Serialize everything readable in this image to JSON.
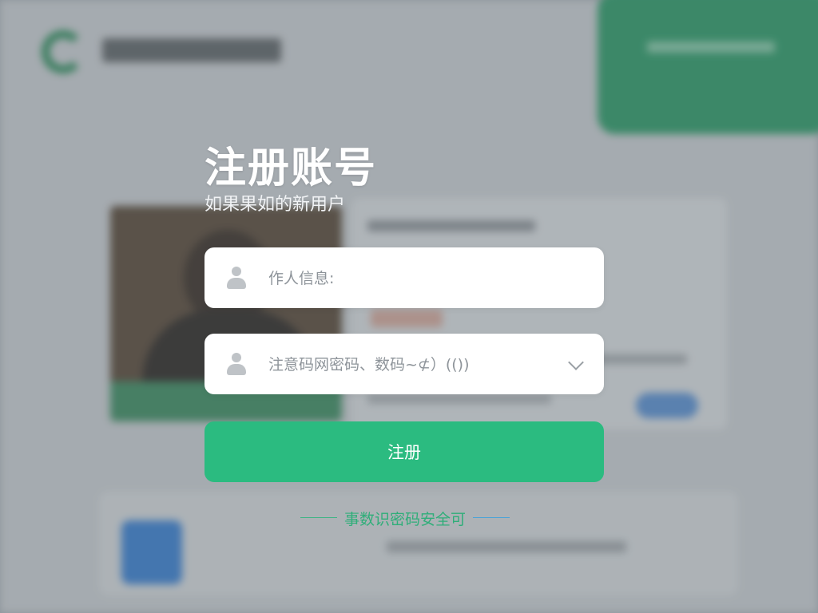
{
  "colors": {
    "accent": "#2bbb80",
    "title_text": "#ffffff",
    "field_bg": "#ffffff",
    "footnote_text": "#2fae79"
  },
  "signup": {
    "title": "注册账号",
    "subtitle": "如果果如的新用户",
    "name_field": {
      "icon": "user-icon",
      "placeholder": "作人信息:"
    },
    "password_field": {
      "icon": "user-icon",
      "placeholder": "注意码网密码、数码~⊄）(())",
      "dropdown_icon": "chevron-down-icon"
    },
    "submit_label": "注册",
    "footnote": "事数识密码安全可"
  }
}
